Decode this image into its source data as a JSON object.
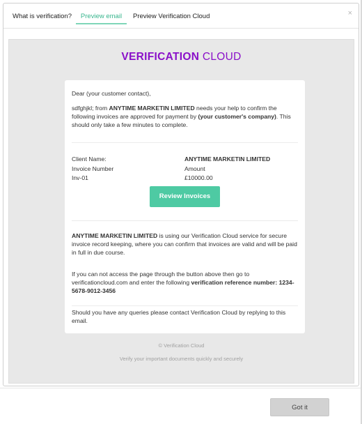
{
  "tabs": [
    {
      "label": "What is verification?"
    },
    {
      "label": "Preview email"
    },
    {
      "label": "Preview Verification Cloud"
    }
  ],
  "close_glyph": "×",
  "brand": {
    "bold": "VERIFICATION",
    "light": "CLOUD"
  },
  "email": {
    "greeting": "Dear (your customer contact),",
    "intro_pre": "sdfghjkl; from ",
    "company": "ANYTIME MARKETIN LIMITED",
    "intro_mid": " needs your help to confirm the following invoices are approved for payment by ",
    "customer_company": "(your customer's company)",
    "intro_post": ". This should only take a few minutes to complete.",
    "client_name_label": "Client Name:",
    "client_name_value": "ANYTIME MARKETIN LIMITED",
    "invoice_number_label": "Invoice Number",
    "amount_label": "Amount",
    "invoice_number_value": "Inv-01",
    "amount_value": "£10000.00",
    "review_button": "Review Invoices",
    "para1_company": "ANYTIME MARKETIN LIMITED",
    "para1_rest": " is using our Verification Cloud service for secure invoice record keeping, where you can confirm that invoices are valid and will be paid in full in due course.",
    "para2_pre": "If you can not access the page through the button above then go to verificationcloud.com and enter the following ",
    "para2_bold": "verification reference number: 1234-5678-9012-3456",
    "para3": "Should you have any queries please contact Verification Cloud by replying to this email."
  },
  "footer": {
    "copyright": "© Verification Cloud",
    "tagline": "Verify your important documents quickly and securely"
  },
  "got_it_button": "Got it",
  "colors": {
    "brand_purple": "#8a10c9",
    "accent_green": "#4ecaa3",
    "active_tab_green": "#37b58d"
  }
}
